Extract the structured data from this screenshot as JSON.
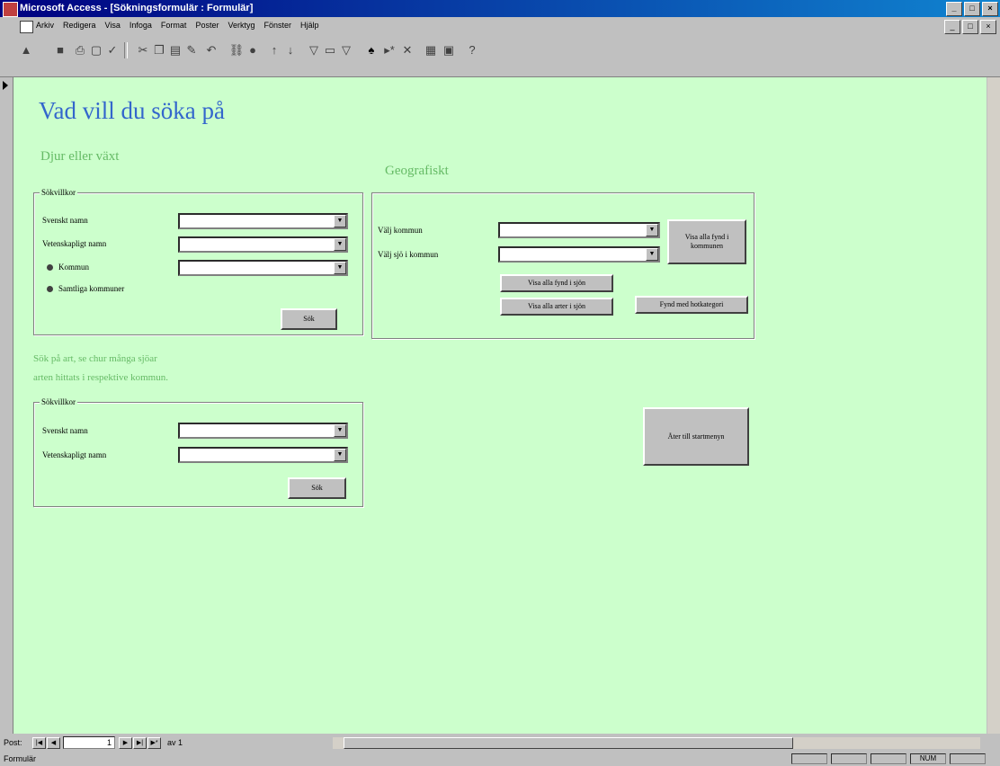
{
  "window": {
    "title": "Microsoft Access - [Sökningsformulär : Formulär]",
    "buttons": [
      "_",
      "□",
      "×"
    ]
  },
  "menubar": {
    "items": [
      "Arkiv",
      "Redigera",
      "Visa",
      "Infoga",
      "Format",
      "Poster",
      "Verktyg",
      "Fönster",
      "Hjälp"
    ],
    "mdi_buttons": [
      "_",
      "□",
      "×"
    ]
  },
  "toolbar": {
    "icons": [
      "design-view-icon",
      "save-icon",
      "print-icon",
      "print-preview-icon",
      "spelling-icon",
      "cut-icon",
      "copy-icon",
      "paste-icon",
      "format-painter-icon",
      "undo-icon",
      "insert-hyperlink-icon",
      "web-toolbar-icon",
      "sort-ascending-icon",
      "sort-descending-icon",
      "filter-by-selection-icon",
      "filter-by-form-icon",
      "apply-filter-icon",
      "find-icon",
      "new-record-icon",
      "delete-record-icon",
      "database-window-icon",
      "new-object-icon",
      "help-icon"
    ]
  },
  "form": {
    "heading": "Vad vill du söka på",
    "section_djur": {
      "title": "Djur eller växt",
      "frame_label": "Sökvillkor",
      "svenskt_label": "Svenskt namn",
      "vetenskapligt_label": "Vetenskapligt namn",
      "kommun_option": "Kommun",
      "samtliga_option": "Samtliga kommuner",
      "search_button": "Sök"
    },
    "section_geo": {
      "title": "Geografiskt",
      "kommun_label": "Välj kommun",
      "sjo_label": "Välj sjö i kommun",
      "visa_alla_fynd_kommun": "Visa alla fynd i kommunen",
      "visa_alla_fynd_sjo": "Visa alla fynd i sjön",
      "visa_alla_arter_sjo": "Visa alla arter i sjön",
      "fynd_hotkategori": "Fynd med hotkategori"
    },
    "section_art": {
      "intro_line1": "Sök på art, se chur många sjöar",
      "intro_line2": "arten hittats i respektive kommun.",
      "frame_label": "Sökvillkor",
      "svenskt_label": "Svenskt namn",
      "vetenskapligt_label": "Vetenskapligt namn",
      "search_button": "Sök"
    },
    "back_button": "Åter till startmenyn"
  },
  "navigator": {
    "post_label": "Post:",
    "record_value": "1",
    "of_label": "av 1"
  },
  "statusbar": {
    "text": "Formulär",
    "panels": [
      "",
      "",
      "",
      "NUM",
      ""
    ]
  }
}
